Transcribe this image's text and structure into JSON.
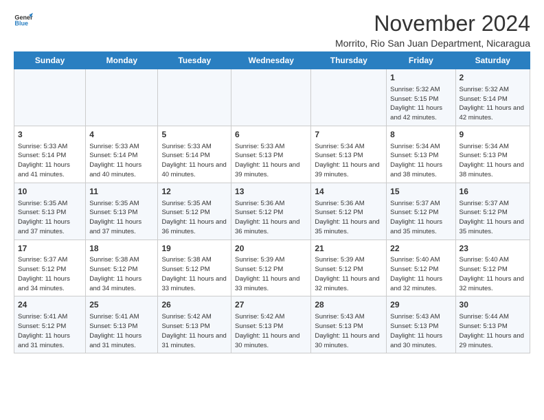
{
  "header": {
    "logo_line1": "General",
    "logo_line2": "Blue",
    "month_title": "November 2024",
    "subtitle": "Morrito, Rio San Juan Department, Nicaragua"
  },
  "weekdays": [
    "Sunday",
    "Monday",
    "Tuesday",
    "Wednesday",
    "Thursday",
    "Friday",
    "Saturday"
  ],
  "weeks": [
    [
      {
        "day": "",
        "info": ""
      },
      {
        "day": "",
        "info": ""
      },
      {
        "day": "",
        "info": ""
      },
      {
        "day": "",
        "info": ""
      },
      {
        "day": "",
        "info": ""
      },
      {
        "day": "1",
        "info": "Sunrise: 5:32 AM\nSunset: 5:15 PM\nDaylight: 11 hours and 42 minutes."
      },
      {
        "day": "2",
        "info": "Sunrise: 5:32 AM\nSunset: 5:14 PM\nDaylight: 11 hours and 42 minutes."
      }
    ],
    [
      {
        "day": "3",
        "info": "Sunrise: 5:33 AM\nSunset: 5:14 PM\nDaylight: 11 hours and 41 minutes."
      },
      {
        "day": "4",
        "info": "Sunrise: 5:33 AM\nSunset: 5:14 PM\nDaylight: 11 hours and 40 minutes."
      },
      {
        "day": "5",
        "info": "Sunrise: 5:33 AM\nSunset: 5:14 PM\nDaylight: 11 hours and 40 minutes."
      },
      {
        "day": "6",
        "info": "Sunrise: 5:33 AM\nSunset: 5:13 PM\nDaylight: 11 hours and 39 minutes."
      },
      {
        "day": "7",
        "info": "Sunrise: 5:34 AM\nSunset: 5:13 PM\nDaylight: 11 hours and 39 minutes."
      },
      {
        "day": "8",
        "info": "Sunrise: 5:34 AM\nSunset: 5:13 PM\nDaylight: 11 hours and 38 minutes."
      },
      {
        "day": "9",
        "info": "Sunrise: 5:34 AM\nSunset: 5:13 PM\nDaylight: 11 hours and 38 minutes."
      }
    ],
    [
      {
        "day": "10",
        "info": "Sunrise: 5:35 AM\nSunset: 5:13 PM\nDaylight: 11 hours and 37 minutes."
      },
      {
        "day": "11",
        "info": "Sunrise: 5:35 AM\nSunset: 5:13 PM\nDaylight: 11 hours and 37 minutes."
      },
      {
        "day": "12",
        "info": "Sunrise: 5:35 AM\nSunset: 5:12 PM\nDaylight: 11 hours and 36 minutes."
      },
      {
        "day": "13",
        "info": "Sunrise: 5:36 AM\nSunset: 5:12 PM\nDaylight: 11 hours and 36 minutes."
      },
      {
        "day": "14",
        "info": "Sunrise: 5:36 AM\nSunset: 5:12 PM\nDaylight: 11 hours and 35 minutes."
      },
      {
        "day": "15",
        "info": "Sunrise: 5:37 AM\nSunset: 5:12 PM\nDaylight: 11 hours and 35 minutes."
      },
      {
        "day": "16",
        "info": "Sunrise: 5:37 AM\nSunset: 5:12 PM\nDaylight: 11 hours and 35 minutes."
      }
    ],
    [
      {
        "day": "17",
        "info": "Sunrise: 5:37 AM\nSunset: 5:12 PM\nDaylight: 11 hours and 34 minutes."
      },
      {
        "day": "18",
        "info": "Sunrise: 5:38 AM\nSunset: 5:12 PM\nDaylight: 11 hours and 34 minutes."
      },
      {
        "day": "19",
        "info": "Sunrise: 5:38 AM\nSunset: 5:12 PM\nDaylight: 11 hours and 33 minutes."
      },
      {
        "day": "20",
        "info": "Sunrise: 5:39 AM\nSunset: 5:12 PM\nDaylight: 11 hours and 33 minutes."
      },
      {
        "day": "21",
        "info": "Sunrise: 5:39 AM\nSunset: 5:12 PM\nDaylight: 11 hours and 32 minutes."
      },
      {
        "day": "22",
        "info": "Sunrise: 5:40 AM\nSunset: 5:12 PM\nDaylight: 11 hours and 32 minutes."
      },
      {
        "day": "23",
        "info": "Sunrise: 5:40 AM\nSunset: 5:12 PM\nDaylight: 11 hours and 32 minutes."
      }
    ],
    [
      {
        "day": "24",
        "info": "Sunrise: 5:41 AM\nSunset: 5:12 PM\nDaylight: 11 hours and 31 minutes."
      },
      {
        "day": "25",
        "info": "Sunrise: 5:41 AM\nSunset: 5:13 PM\nDaylight: 11 hours and 31 minutes."
      },
      {
        "day": "26",
        "info": "Sunrise: 5:42 AM\nSunset: 5:13 PM\nDaylight: 11 hours and 31 minutes."
      },
      {
        "day": "27",
        "info": "Sunrise: 5:42 AM\nSunset: 5:13 PM\nDaylight: 11 hours and 30 minutes."
      },
      {
        "day": "28",
        "info": "Sunrise: 5:43 AM\nSunset: 5:13 PM\nDaylight: 11 hours and 30 minutes."
      },
      {
        "day": "29",
        "info": "Sunrise: 5:43 AM\nSunset: 5:13 PM\nDaylight: 11 hours and 30 minutes."
      },
      {
        "day": "30",
        "info": "Sunrise: 5:44 AM\nSunset: 5:13 PM\nDaylight: 11 hours and 29 minutes."
      }
    ]
  ]
}
